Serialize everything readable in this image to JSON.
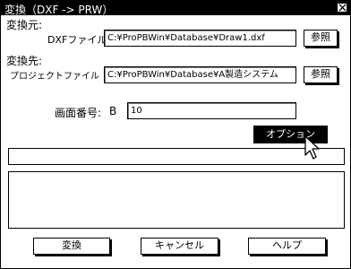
{
  "window": {
    "title": "変換（DXF -> PRW）"
  },
  "source": {
    "section_label": "変換元:",
    "dxf_label": "DXFファイル",
    "dxf_value": "C:¥ProPBWin¥Database¥Draw1.dxf",
    "browse_label": "参照"
  },
  "destination": {
    "section_label": "変換先:",
    "project_label": "プロジェクトファイル",
    "project_value": "C:¥ProPBWin¥Database¥A製造システム",
    "browse_label": "参照"
  },
  "screen": {
    "label": "画面番号:",
    "prefix": "B",
    "value": "10"
  },
  "options_label": "オプション",
  "status_text": "",
  "log_text": "",
  "buttons": {
    "convert": "変換",
    "cancel": "キャンセル",
    "help": "ヘルプ"
  },
  "icons": {
    "close": "close-icon",
    "cursor": "mouse-pointer-icon"
  }
}
